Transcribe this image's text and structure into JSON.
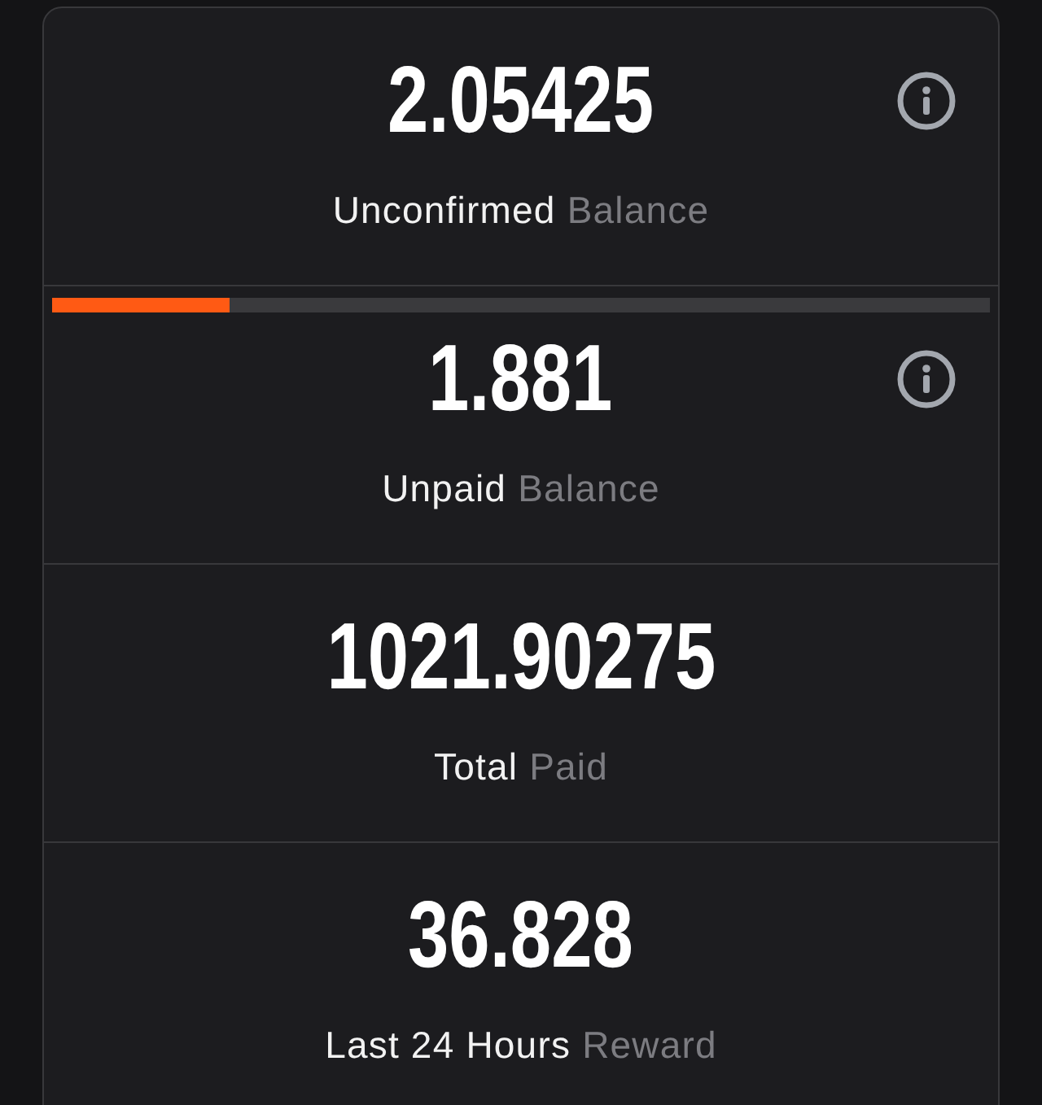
{
  "stats": [
    {
      "value": "2.05425",
      "label": "Unconfirmed",
      "label_muted": "Balance",
      "info_button": true
    },
    {
      "value": "1.881",
      "label": "Unpaid",
      "label_muted": "Balance",
      "info_button": true,
      "progress": {
        "level": 0.19
      }
    },
    {
      "value": "1021.90275",
      "label": "Total",
      "label_muted": "Paid"
    },
    {
      "value": "36.828",
      "label": "Last 24 Hours",
      "label_muted": "Reward"
    }
  ]
}
